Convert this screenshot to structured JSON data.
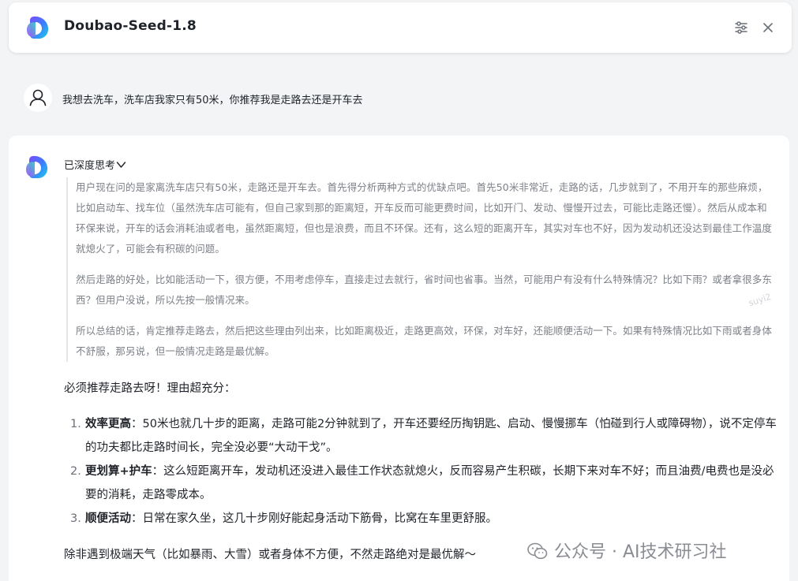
{
  "header": {
    "title": "Doubao-Seed-1.8",
    "icons": {
      "logo": "doubao-logo",
      "settings": "sliders-icon",
      "close": "close-icon"
    }
  },
  "user_message": {
    "avatar_icon": "user-icon",
    "text": "我想去洗车，洗车店我家只有50米，你推荐我是走路去还是开车去"
  },
  "assistant": {
    "thought_label": "已深度思考",
    "thinking_paragraphs": [
      "用户现在问的是家离洗车店只有50米，走路还是开车去。首先得分析两种方式的优缺点吧。首先50米非常近，走路的话，几步就到了，不用开车的那些麻烦，比如启动车、找车位（虽然洗车店可能有，但自己家到那的距离短，开车反而可能更费时间，比如开门、发动、慢慢开过去，可能比走路还慢）。然后从成本和环保来说，开车的话会消耗油或者电，虽然距离短，但也是浪费，而且不环保。还有，这么短的距离开车，其实对车也不好，因为发动机还没达到最佳工作温度就熄火了，可能会有积碳的问题。",
      "然后走路的好处，比如能活动一下，很方便，不用考虑停车，直接走过去就行，省时间也省事。当然，可能用户有没有什么特殊情况？比如下雨？或者拿很多东西？但用户没说，所以先按一般情况来。",
      "所以总结的话，肯定推荐走路去，然后把这些理由列出来，比如距离极近，走路更高效，环保，对车好，还能顺便活动一下。如果有特殊情况比如下雨或者身体不舒服，那另说，但一般情况走路是最优解。"
    ],
    "intro": "必须推荐走路去呀！理由超充分：",
    "points": [
      {
        "num": "1.",
        "title": "效率更高",
        "body": "：50米也就几十步的距离，走路可能2分钟就到了，开车还要经历掏钥匙、启动、慢慢挪车（怕碰到行人或障碍物），说不定停车的功夫都比走路时间长，完全没必要“大动干戈”。"
      },
      {
        "num": "2.",
        "title": "更划算+护车",
        "body": "：这么短距离开车，发动机还没进入最佳工作状态就熄火，反而容易产生积碳，长期下来对车不好；而且油费/电费也是没必要的消耗，走路零成本。"
      },
      {
        "num": "3.",
        "title": "顺便活动",
        "body": "：日常在家久坐，这几十步刚好能起身活动下筋骨，比窝在车里更舒服。"
      }
    ],
    "outro": "除非遇到极端天气（比如暴雨、大雪）或者身体不方便，不然走路绝对是最优解～"
  },
  "watermark": {
    "text": "公众号 · AI技术研习社",
    "icon": "wechat-icon"
  },
  "faint_mark": "suyi2",
  "colors": {
    "background": "#f3f4f6",
    "card": "#ffffff",
    "thinking_text": "#7c8087",
    "thinking_border": "#e3e5e8"
  }
}
